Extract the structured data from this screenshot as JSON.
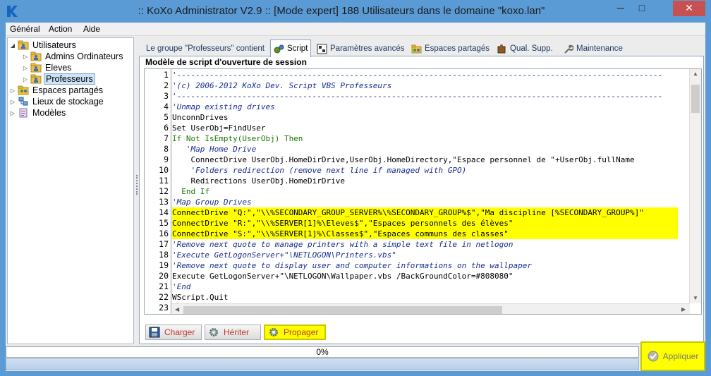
{
  "window": {
    "title": ":: KoXo Administrator V2.9 :: [Mode expert] 188 Utilisateurs dans le domaine \"koxo.lan\"",
    "min": "─",
    "max": "□",
    "close": "✕"
  },
  "menu": [
    "Général",
    "Action",
    "Aide"
  ],
  "tree": {
    "utilisateurs": "Utilisateurs",
    "admins": "Admins Ordinateurs",
    "eleves": "Eleves",
    "professeurs": "Professeurs",
    "espaces": "Espaces partagés",
    "lieux": "Lieux de stockage",
    "modeles": "Modèles"
  },
  "tabs": [
    "Le groupe \"Professeurs\" contient",
    "Script",
    "Paramètres avancés",
    "Espaces partagés",
    "Qual. Supp.",
    "Maintenance"
  ],
  "panel_title": "Modèle de script d'ouverture de session",
  "code_lines": [
    "'--------------------------------------------------------------------------------------------------------",
    "'(c) 2006-2012 KoXo Dev. Script VBS Professeurs",
    "'--------------------------------------------------------------------------------------------------------",
    "'Unmap existing drives",
    "UnconnDrives",
    "Set UserObj=FindUser",
    "If Not IsEmpty(UserObj) Then",
    "   'Map Home Drive",
    "    ConnectDrive UserObj.HomeDirDrive,UserObj.HomeDirectory,\"Espace personnel de \"+UserObj.fullName",
    "    'Folders redirection (remove next line if managed with GPO)",
    "    Redirections UserObj.HomeDirDrive",
    "  End If",
    "'Map Group Drives",
    "ConnectDrive \"Q:\",\"\\\\%SECONDARY_GROUP_SERVER%\\%SECONDARY_GROUP%$\",\"Ma discipline [%SECONDARY_GROUP%]\"",
    "ConnectDrive \"R:\",\"\\\\%SERVER[1]%\\Eleves$\",\"Espaces personnels des élèves\"",
    "ConnectDrive \"S:\",\"\\\\%SERVER[1]%\\Classes$\",\"Espaces communs des classes\"",
    "'Remove next quote to manage printers with a simple text file in netlogon",
    "'Execute GetLogonServer+\"\\NETLOGON\\Printers.vbs\"",
    "'Remove next quote to display user and computer informations on the wallpaper",
    "Execute GetLogonServer+\"\\NETLOGON\\Wallpaper.vbs /BackGroundColor=#808080\"",
    "'End",
    "WScript.Quit",
    "'--------------------------------------------------------------------------------------------------------"
  ],
  "line_numbers": [
    "1",
    "2",
    "3",
    "4",
    "5",
    "6",
    "7",
    "8",
    "9",
    "10",
    "11",
    "12",
    "13",
    "14",
    "15",
    "16",
    "17",
    "18",
    "19",
    "20",
    "21",
    "22",
    "23"
  ],
  "buttons": {
    "charger": "Charger",
    "heriter": "Hériter",
    "propager": "Propager"
  },
  "progress": {
    "text": "0%",
    "value": 0
  },
  "apply_label": "Appliquer",
  "colors": {
    "highlight": "#ffff00",
    "titlebar": "#5b9bd5",
    "comment": "#1a2d8f",
    "keyword": "#1a7a00"
  }
}
